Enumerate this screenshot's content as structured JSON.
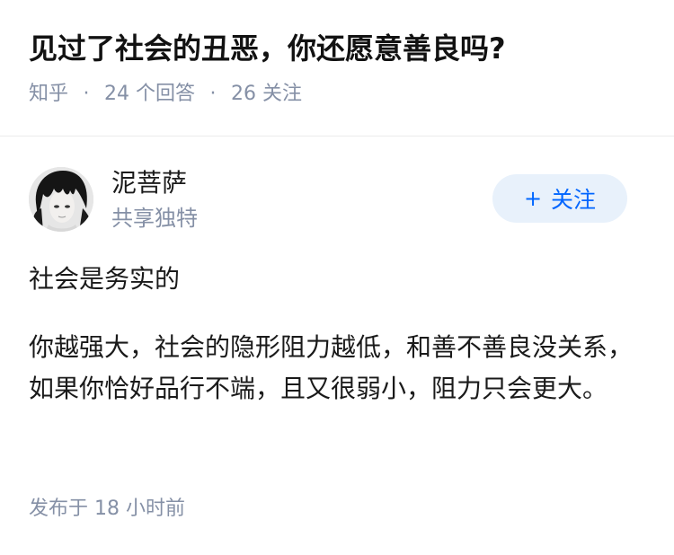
{
  "question": {
    "title": "见过了社会的丑恶，你还愿意善良吗?",
    "source": "知乎",
    "separator": "·",
    "answers_count": "24 个回答",
    "followers_count": "26 关注"
  },
  "author": {
    "name": "泥菩萨",
    "bio": "共享独特",
    "avatar_icon": "avatar-image",
    "follow_button": {
      "icon": "+",
      "label": "关注"
    }
  },
  "answer": {
    "paragraphs": [
      "社会是务实的",
      "你越强大，社会的隐形阻力越低，和善不善良没关系，如果你恰好品行不端，且又很弱小，阻力只会更大。"
    ],
    "time": "发布于  18 小时前"
  },
  "colors": {
    "title": "#121212",
    "meta": "#8590a6",
    "accent": "#0066ff",
    "button_bg": "#e8f1fb"
  }
}
